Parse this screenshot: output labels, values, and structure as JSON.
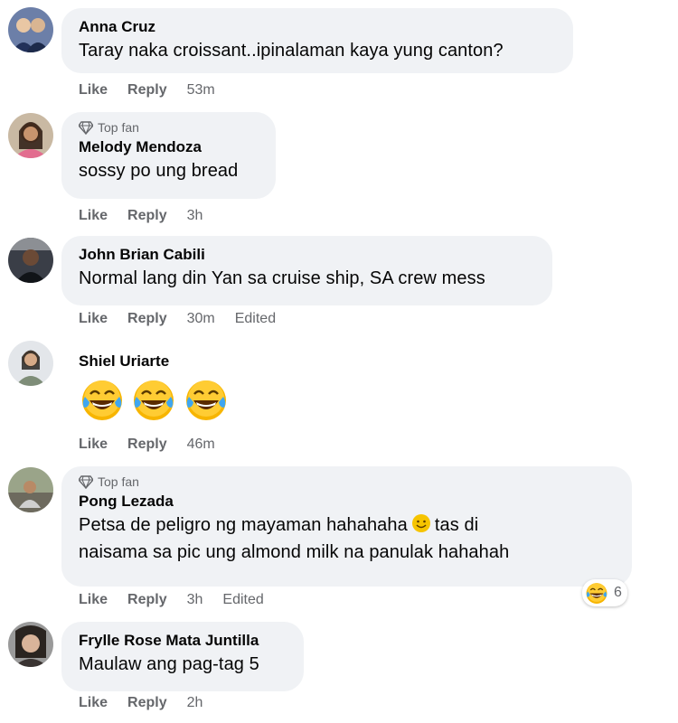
{
  "comments": [
    {
      "author": "Anna Cruz",
      "text": "Taray naka croissant..ipinalaman kaya yung canton?",
      "like": "Like",
      "reply": "Reply",
      "time": "53m"
    },
    {
      "badge": "Top fan",
      "author": "Melody Mendoza",
      "text": "sossy po ung bread",
      "like": "Like",
      "reply": "Reply",
      "time": "3h"
    },
    {
      "author": "John Brian Cabili",
      "text": "Normal lang din Yan sa cruise ship, SA crew mess",
      "like": "Like",
      "reply": "Reply",
      "time": "30m",
      "edited": "Edited"
    },
    {
      "author": "Shiel Uriarte",
      "emojis": [
        "laughing-tears",
        "laughing-tears",
        "laughing-tears"
      ],
      "like": "Like",
      "reply": "Reply",
      "time": "46m"
    },
    {
      "badge": "Top fan",
      "author": "Pong Lezada",
      "text_line1_a": "Petsa de peligro ng mayaman hahahaha",
      "text_line1_b": "tas di",
      "text_line2": "naisama sa pic ung almond milk na panulak hahahah",
      "like": "Like",
      "reply": "Reply",
      "time": "3h",
      "edited": "Edited",
      "reaction": {
        "icon": "haha",
        "count": "6"
      }
    },
    {
      "author": "Frylle Rose Mata Juntilla",
      "text": "Maulaw ang pag-tag 5",
      "like": "Like",
      "reply": "Reply",
      "time": "2h"
    }
  ]
}
